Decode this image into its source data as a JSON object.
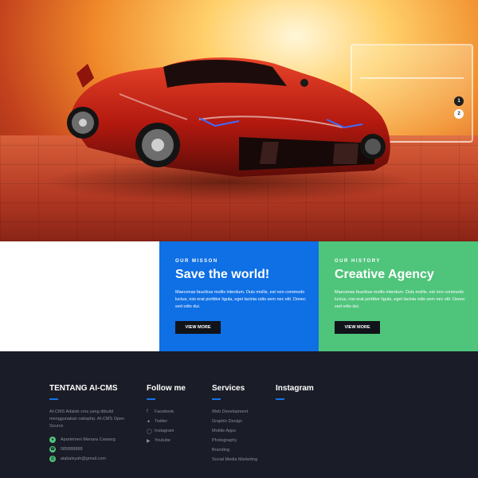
{
  "hero": {
    "slider_dots": [
      "1",
      "2"
    ]
  },
  "missions": [
    {
      "kicker": "OUR MISSON",
      "title": "Save the world!",
      "text": "Maecenas faucibus mollis interdum. Duis mollis, est non commodo luctus, nisi erat porttitor ligula, eget lacinia odio sem nec elit. Donec sed odio dui.",
      "button": "VIEW MORE",
      "color": "#0f6fe4"
    },
    {
      "kicker": "OUR HISTORY",
      "title": "Creative Agency",
      "text": "Maecenas faucibus mollis interdum. Duis mollis, est non commodo luctus, nisi erat porttitor ligula, eget lacinia odio sem nec elit. Donec sed odio dui.",
      "button": "VIEW MORE",
      "color": "#4fc47b"
    }
  ],
  "footer": {
    "about": {
      "heading": "TENTANG AI-CMS",
      "text": "AI-CMS Adalah cms yang dibuild menggunakan cakephp. AI-CMS Open Source",
      "address": "Apartemen Menara Cawang",
      "phone": "085888888",
      "email": "aiqbalsyah@gmail.com"
    },
    "follow": {
      "heading": "Follow me",
      "items": [
        {
          "icon": "facebook-icon",
          "label": "Facebook"
        },
        {
          "icon": "twitter-icon",
          "label": "Twitter"
        },
        {
          "icon": "instagram-icon",
          "label": "Instagram"
        },
        {
          "icon": "youtube-icon",
          "label": "Youtube"
        }
      ]
    },
    "services": {
      "heading": "Services",
      "items": [
        "Web Development",
        "Graphic Design",
        "Mobile Apps",
        "Photography",
        "Branding",
        "Social Media Marketing"
      ]
    },
    "instagram": {
      "heading": "Instagram"
    }
  },
  "colors": {
    "blue": "#0f6fe4",
    "green": "#4fc47b",
    "footer_bg": "#1a1c27",
    "button_bg": "#11131a"
  }
}
